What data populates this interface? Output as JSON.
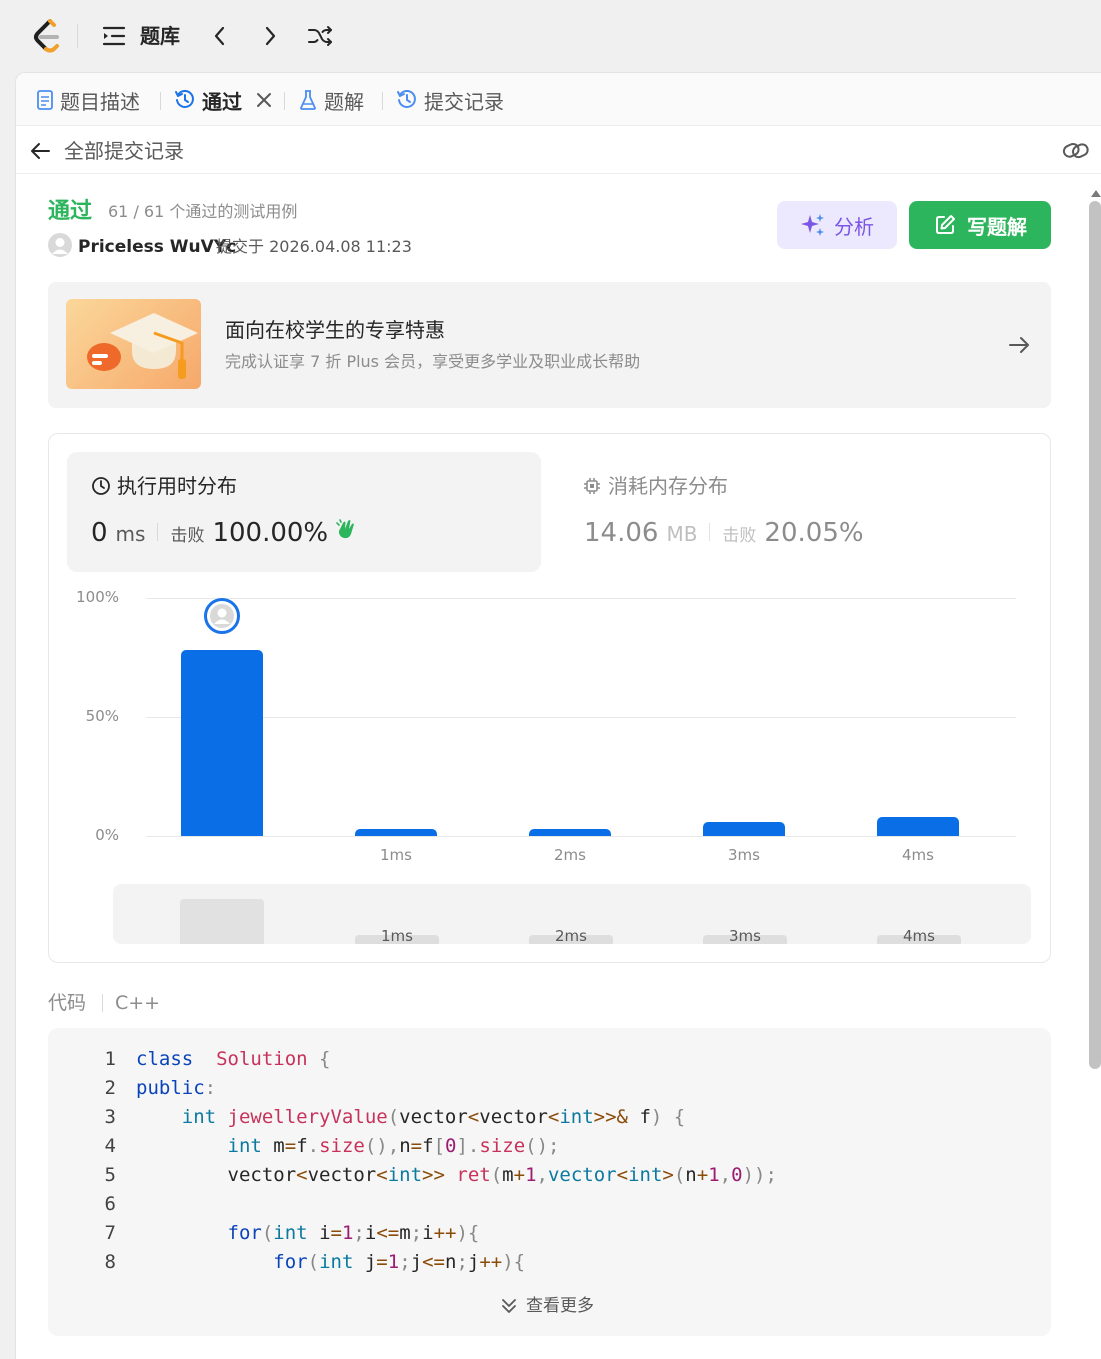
{
  "topbar": {
    "title": "题库"
  },
  "tabs": [
    {
      "label": "题目描述"
    },
    {
      "label": "通过"
    },
    {
      "label": "题解"
    },
    {
      "label": "提交记录"
    }
  ],
  "subheader": {
    "title": "全部提交记录"
  },
  "submission": {
    "status": "通过",
    "cases": "61 / 61 个通过的测试用例",
    "user": "Priceless WuVYc",
    "submitted": "提交于 2026.04.08 11:23",
    "analyze_label": "分析",
    "write_label": "写题解"
  },
  "promo": {
    "title": "面向在校学生的专享特惠",
    "subtitle": "完成认证享 7 折 Plus 会员，享受更多学业及职业成长帮助"
  },
  "stats": {
    "runtime": {
      "label": "执行用时分布",
      "value": "0",
      "unit": "ms",
      "beat_label": "击败",
      "beat": "100.00%"
    },
    "memory": {
      "label": "消耗内存分布",
      "value": "14.06",
      "unit": "MB",
      "beat_label": "击败",
      "beat": "20.05%"
    }
  },
  "chart_data": {
    "type": "bar",
    "categories": [
      "",
      "1ms",
      "2ms",
      "3ms",
      "4ms"
    ],
    "values": [
      78,
      3,
      3,
      6,
      8
    ],
    "y_ticks": [
      "100%",
      "50%",
      "0%"
    ],
    "ylim": [
      0,
      100
    ],
    "grid": true,
    "highlight_index": 0,
    "accent": "#0a6ee6"
  },
  "minimap": {
    "labels": [
      "1ms",
      "2ms",
      "3ms",
      "4ms"
    ]
  },
  "code": {
    "label": "代码",
    "language": "C++",
    "lines": [
      [
        [
          "kw",
          "class"
        ],
        [
          "",
          "  "
        ],
        [
          "fn",
          "Solution"
        ],
        [
          "",
          ""
        ],
        [
          "pu",
          " {"
        ]
      ],
      [
        [
          "kw",
          "public"
        ],
        [
          "pu",
          ":"
        ]
      ],
      [
        [
          "",
          "    "
        ],
        [
          "ty",
          "int"
        ],
        [
          "",
          " "
        ],
        [
          "fn",
          "jewelleryValue"
        ],
        [
          "pu",
          "("
        ],
        [
          "",
          "vector"
        ],
        [
          "op",
          "<"
        ],
        [
          "",
          "vector"
        ],
        [
          "op",
          "<"
        ],
        [
          "ty",
          "int"
        ],
        [
          "op",
          ">>&"
        ],
        [
          "",
          " f"
        ],
        [
          "pu",
          ")"
        ],
        [
          "pu",
          " {"
        ]
      ],
      [
        [
          "",
          "        "
        ],
        [
          "ty",
          "int"
        ],
        [
          "",
          " m"
        ],
        [
          "op",
          "="
        ],
        [
          "",
          "f"
        ],
        [
          "pu",
          "."
        ],
        [
          "fn",
          "size"
        ],
        [
          "pu",
          "()"
        ],
        [
          "pu",
          ","
        ],
        [
          "",
          "n"
        ],
        [
          "op",
          "="
        ],
        [
          "",
          "f"
        ],
        [
          "pu",
          "["
        ],
        [
          "nm",
          "0"
        ],
        [
          "pu",
          "]"
        ],
        [
          "pu",
          "."
        ],
        [
          "fn",
          "size"
        ],
        [
          "pu",
          "();"
        ]
      ],
      [
        [
          "",
          "        vector"
        ],
        [
          "op",
          "<"
        ],
        [
          "",
          "vector"
        ],
        [
          "op",
          "<"
        ],
        [
          "ty",
          "int"
        ],
        [
          "op",
          ">>"
        ],
        [
          "",
          " "
        ],
        [
          "fn",
          "ret"
        ],
        [
          "pu",
          "("
        ],
        [
          "",
          "m"
        ],
        [
          "op",
          "+"
        ],
        [
          "nm",
          "1"
        ],
        [
          "pu",
          ","
        ],
        [
          "ty",
          "vector"
        ],
        [
          "op",
          "<"
        ],
        [
          "ty",
          "int"
        ],
        [
          "op",
          ">"
        ],
        [
          "pu",
          "("
        ],
        [
          "",
          "n"
        ],
        [
          "op",
          "+"
        ],
        [
          "nm",
          "1"
        ],
        [
          "pu",
          ","
        ],
        [
          "nm",
          "0"
        ],
        [
          "pu",
          "));"
        ]
      ],
      [
        [
          "",
          ""
        ]
      ],
      [
        [
          "",
          "        "
        ],
        [
          "kw",
          "for"
        ],
        [
          "pu",
          "("
        ],
        [
          "ty",
          "int"
        ],
        [
          "",
          " i"
        ],
        [
          "op",
          "="
        ],
        [
          "nm",
          "1"
        ],
        [
          "pu",
          ";"
        ],
        [
          "",
          "i"
        ],
        [
          "op",
          "<="
        ],
        [
          "",
          "m"
        ],
        [
          "pu",
          ";"
        ],
        [
          "",
          "i"
        ],
        [
          "op",
          "++"
        ],
        [
          "pu",
          "){"
        ]
      ],
      [
        [
          "",
          "            "
        ],
        [
          "kw",
          "for"
        ],
        [
          "pu",
          "("
        ],
        [
          "ty",
          "int"
        ],
        [
          "",
          " j"
        ],
        [
          "op",
          "="
        ],
        [
          "nm",
          "1"
        ],
        [
          "pu",
          ";"
        ],
        [
          "",
          "j"
        ],
        [
          "op",
          "<="
        ],
        [
          "",
          "n"
        ],
        [
          "pu",
          ";"
        ],
        [
          "",
          "j"
        ],
        [
          "op",
          "++"
        ],
        [
          "pu",
          "){"
        ]
      ]
    ],
    "show_more_label": "查看更多"
  }
}
